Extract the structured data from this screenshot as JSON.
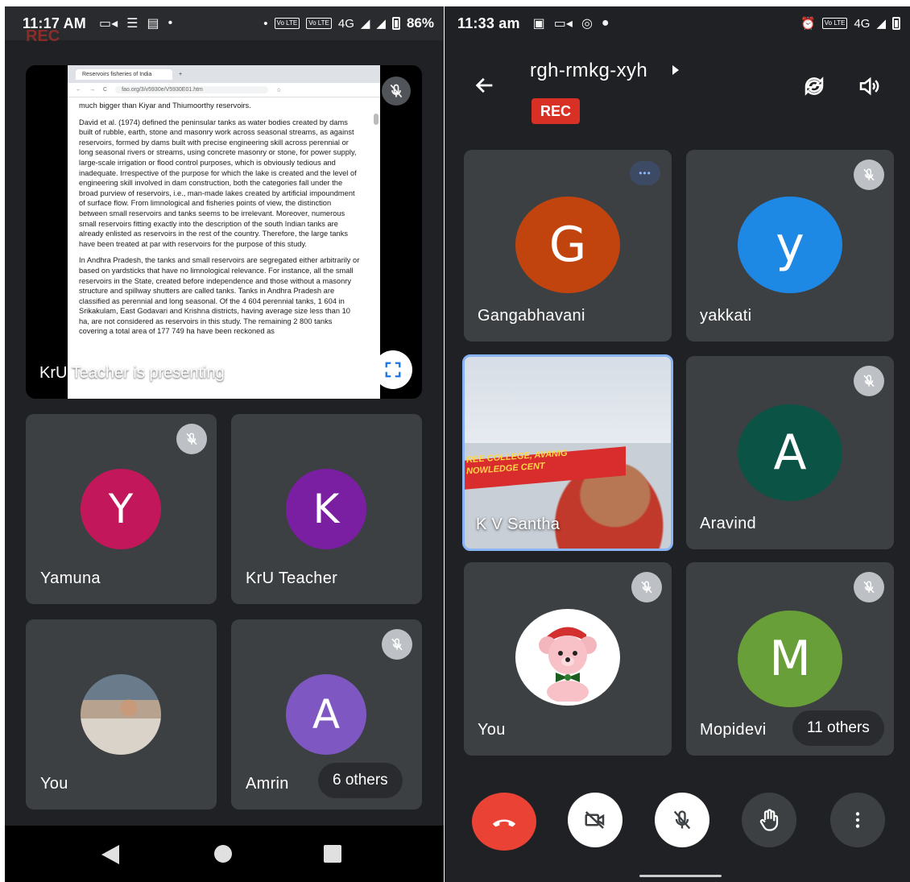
{
  "left_screen": {
    "status_bar": {
      "time": "11:17 AM",
      "network": "4G",
      "battery": "86%",
      "ghost_text": "REC"
    },
    "presentation": {
      "label": "KrU Teacher is presenting",
      "document": {
        "tab_title": "Reservoirs fisheries of India",
        "url": "fao.org/3/v5930e/V5930E01.htm",
        "paragraph_0": "much bigger than Kiyar and Thiumoorthy reservoirs.",
        "paragraph_1": "David et al. (1974) defined the peninsular tanks as water bodies created by dams built of rubble, earth, stone and masonry work across seasonal streams, as against reservoirs, formed by dams built with precise engineering skill across perennial or long seasonal rivers or streams, using concrete masonry or stone, for power supply, large-scale irrigation or flood control purposes, which is obviously tedious and inadequate. Irrespective of the purpose for which the lake is created and the level of engineering skill involved in dam construction, both the categories fall under the broad purview of reservoirs, i.e., man-made lakes created by artificial impoundment of surface flow. From limnological and fisheries points of view, the distinction between small reservoirs and tanks seems to be irrelevant. Moreover, numerous small reservoirs fitting exactly into the description of the south Indian tanks are already enlisted as reservoirs in the rest of the country. Therefore, the large tanks have been treated at par with reservoirs for the purpose of this study.",
        "paragraph_2": "In Andhra Pradesh, the tanks and small reservoirs are segregated either arbitrarily or based on yardsticks that have no limnological relevance. For instance, all the small reservoirs in the State, created before independence and those without a masonry structure and spillway shutters are called tanks. Tanks in Andhra Pradesh are classified as perennial and long seasonal. Of the 4 604 perennial tanks, 1 604 in Srikakulam, East Godavari and Krishna districts, having average size less than 10 ha, are not considered as reservoirs in this study. The remaining 2 800 tanks covering a total area of 177 749 ha have been reckoned as"
      }
    },
    "tiles": [
      {
        "name": "Yamuna",
        "initial": "Y",
        "color": "#c2185b",
        "muted": true
      },
      {
        "name": "KrU Teacher",
        "initial": "K",
        "color": "#7b1fa2",
        "muted": false
      },
      {
        "name": "You",
        "initial": "",
        "color": "",
        "muted": false
      },
      {
        "name": "Amrin",
        "initial": "A",
        "color": "#7e57c2",
        "muted": true
      }
    ],
    "others_label": "6 others"
  },
  "right_screen": {
    "status_bar": {
      "time": "11:33 am",
      "network": "4G"
    },
    "meeting_code": "rgh-rmkg-xyh",
    "rec_label": "REC",
    "tiles": [
      {
        "name": "Gangabhavani",
        "initial": "G",
        "color": "#c1440e",
        "muted": false
      },
      {
        "name": "yakkati",
        "initial": "y",
        "color": "#1e88e5",
        "muted": true
      },
      {
        "name": "K V Santha",
        "initial": "",
        "color": "",
        "muted": false
      },
      {
        "name": "Aravind",
        "initial": "A",
        "color": "#0b5345",
        "muted": true
      },
      {
        "name": "You",
        "initial": "",
        "color": "",
        "muted": true
      },
      {
        "name": "Mopidevi",
        "initial": "M",
        "color": "#689f38",
        "muted": true
      }
    ],
    "others_label": "11 others",
    "banner_line_1": "REE COLLEGE, AVANIG",
    "banner_line_2": "NOWLEDGE CENT"
  },
  "colors": {
    "background": "#202124",
    "tile": "#3c4043",
    "hangup": "#ea4335",
    "rec": "#d93025",
    "active_border": "#8ab4f8"
  },
  "icons": [
    "back-arrow-icon",
    "switch-camera-icon",
    "speaker-icon",
    "mic-off-icon",
    "camera-off-icon",
    "hand-raise-icon",
    "more-vert-icon",
    "end-call-icon",
    "fullscreen-icon"
  ]
}
